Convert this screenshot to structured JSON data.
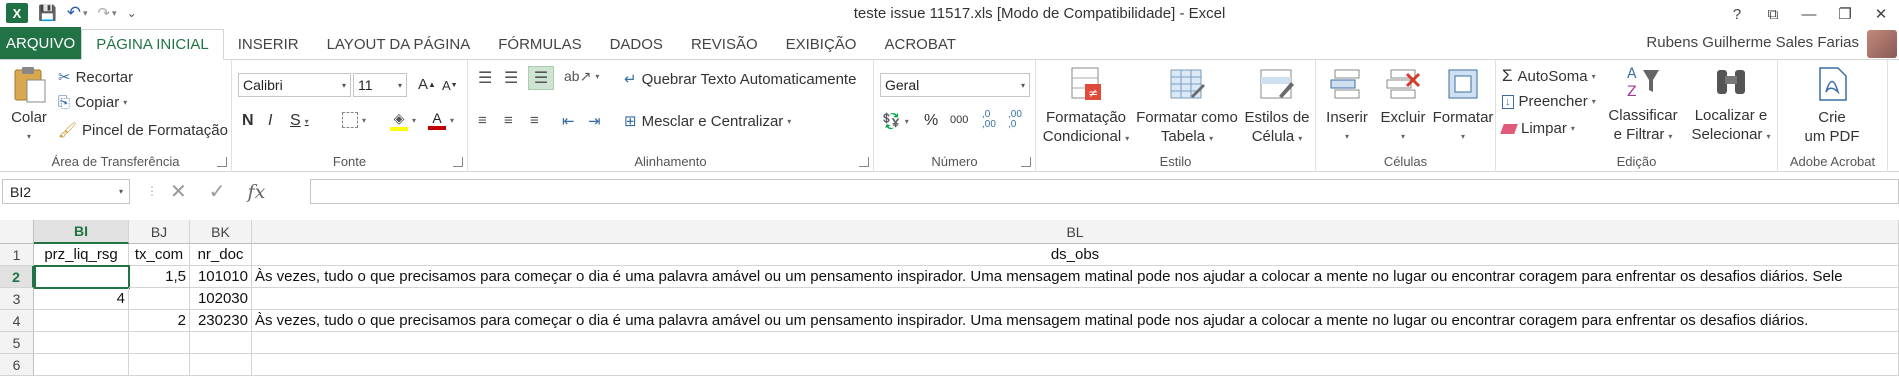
{
  "window": {
    "title": "teste issue 11517.xls  [Modo de Compatibilidade] - Excel",
    "help": "?",
    "controls": [
      "⧉",
      "—",
      "❐",
      "✕"
    ]
  },
  "qat": {
    "logo": "X",
    "save": "💾",
    "undo": "↶",
    "redo": "↷",
    "customize": "⌄"
  },
  "tabs": [
    "ARQUIVO",
    "PÁGINA INICIAL",
    "INSERIR",
    "LAYOUT DA PÁGINA",
    "FÓRMULAS",
    "DADOS",
    "REVISÃO",
    "EXIBIÇÃO",
    "ACROBAT"
  ],
  "user": "Rubens Guilherme Sales Farias",
  "ribbon": {
    "clipboard": {
      "label": "Área de Transferência",
      "paste": "Colar",
      "cut": "Recortar",
      "copy": "Copiar",
      "format_painter": "Pincel de Formatação"
    },
    "font": {
      "label": "Fonte",
      "family": "Calibri",
      "size": "11",
      "grow": "A",
      "shrink": "A",
      "bold": "N",
      "italic": "I",
      "underline": "S",
      "font_color_letter": "A"
    },
    "alignment": {
      "label": "Alinhamento",
      "wrap": "Quebrar Texto Automaticamente",
      "merge": "Mesclar e Centralizar"
    },
    "number": {
      "label": "Número",
      "format": "Geral",
      "percent": "%",
      "thousands": "000",
      "inc": ",0 ,00",
      "dec": ",00 ,0"
    },
    "styles": {
      "label": "Estilo",
      "conditional_1": "Formatação",
      "conditional_2": "Condicional",
      "table_1": "Formatar como",
      "table_2": "Tabela",
      "cell_1": "Estilos de",
      "cell_2": "Célula"
    },
    "cells": {
      "label": "Células",
      "insert": "Inserir",
      "delete": "Excluir",
      "format": "Formatar"
    },
    "editing": {
      "label": "Edição",
      "autosum": "AutoSoma",
      "fill": "Preencher",
      "clear": "Limpar",
      "sort_1": "Classificar",
      "sort_2": "e Filtrar",
      "find_1": "Localizar e",
      "find_2": "Selecionar"
    },
    "acrobat": {
      "label": "Adobe Acrobat",
      "create_1": "Crie",
      "create_2": "um PDF"
    }
  },
  "formula_bar": {
    "name_box": "BI2",
    "fx": "fx",
    "cancel": "✕",
    "enter": "✓",
    "value": ""
  },
  "grid": {
    "columns": [
      "BI",
      "BJ",
      "BK",
      "BL"
    ],
    "rows": [
      "1",
      "2",
      "3",
      "4",
      "5",
      "6"
    ],
    "cells": {
      "BI1": "prz_liq_rsg",
      "BJ1": "tx_com",
      "BK1": "nr_doc",
      "BL1": "ds_obs",
      "BI2": "",
      "BJ2": "1,5",
      "BK2": "101010",
      "BL2": "Às vezes, tudo o que precisamos para começar o dia é uma palavra amável ou um pensamento inspirador. Uma mensagem matinal pode nos ajudar a colocar a mente no lugar ou encontrar coragem para enfrentar os desafios diários. Sele",
      "BI3": "4",
      "BJ3": "",
      "BK3": "102030",
      "BL3": "",
      "BI4": "",
      "BJ4": "2",
      "BK4": "230230",
      "BL4": "Às vezes, tudo o que precisamos para começar o dia é uma palavra amável ou um pensamento inspirador. Uma mensagem matinal pode nos ajudar a colocar a mente no lugar ou encontrar coragem para enfrentar os desafios diários."
    }
  },
  "colors": {
    "excel_green": "#217346",
    "font_color_red": "#c00000",
    "highlight_yellow": "#ffff00"
  }
}
